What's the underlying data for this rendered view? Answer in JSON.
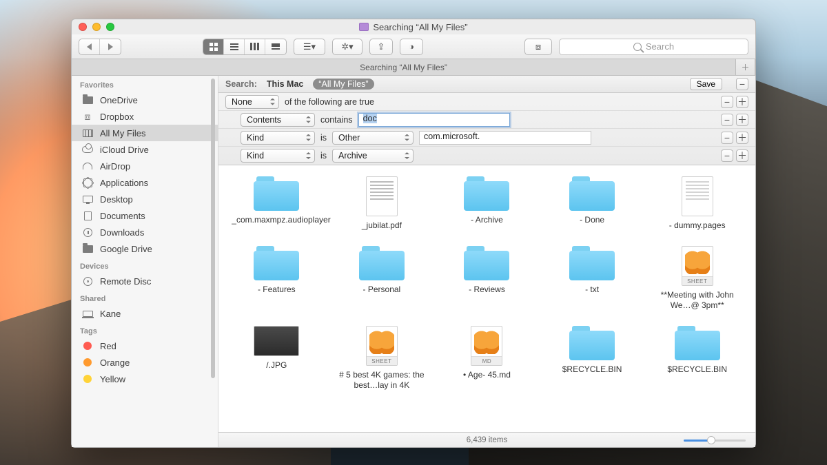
{
  "window": {
    "title": "Searching “All My Files”"
  },
  "toolbar": {
    "search_placeholder": "Search"
  },
  "tab": {
    "label": "Searching “All My Files”"
  },
  "sidebar": {
    "groups": {
      "favorites": "Favorites",
      "devices": "Devices",
      "shared": "Shared",
      "tags": "Tags"
    },
    "favorites": [
      {
        "label": "OneDrive"
      },
      {
        "label": "Dropbox"
      },
      {
        "label": "All My Files"
      },
      {
        "label": "iCloud Drive"
      },
      {
        "label": "AirDrop"
      },
      {
        "label": "Applications"
      },
      {
        "label": "Desktop"
      },
      {
        "label": "Documents"
      },
      {
        "label": "Downloads"
      },
      {
        "label": "Google Drive"
      }
    ],
    "devices": [
      {
        "label": "Remote Disc"
      }
    ],
    "shared": [
      {
        "label": "Kane"
      }
    ],
    "tags": [
      {
        "label": "Red",
        "color": "#ff5b51"
      },
      {
        "label": "Orange",
        "color": "#ff9a2e"
      },
      {
        "label": "Yellow",
        "color": "#ffd338"
      }
    ]
  },
  "search": {
    "label": "Search:",
    "scopes": [
      {
        "label": "This Mac",
        "active": false
      },
      {
        "label": "“All My Files”",
        "active": true
      }
    ],
    "save": "Save"
  },
  "criteria": {
    "root": {
      "select": "None",
      "text": "of the following are true"
    },
    "rows": [
      {
        "attr": "Contents",
        "op": "contains",
        "valueType": "text-focused",
        "value": "doc"
      },
      {
        "attr": "Kind",
        "op": "is",
        "valueType": "select+text",
        "select": "Other",
        "value": "com.microsoft."
      },
      {
        "attr": "Kind",
        "op": "is",
        "valueType": "select",
        "select": "Archive"
      }
    ]
  },
  "results": [
    {
      "kind": "folder",
      "name": "_com.maxmpz.audioplayer"
    },
    {
      "kind": "doc",
      "name": "_jubilat.pdf"
    },
    {
      "kind": "folder",
      "name": "- Archive"
    },
    {
      "kind": "folder",
      "name": "- Done"
    },
    {
      "kind": "doctxt",
      "name": "- dummy.pages"
    },
    {
      "kind": "folder",
      "name": "- Features"
    },
    {
      "kind": "folder",
      "name": "- Personal"
    },
    {
      "kind": "folder",
      "name": "- Reviews"
    },
    {
      "kind": "folder",
      "name": "- txt"
    },
    {
      "kind": "sheet",
      "tag": "SHEET",
      "name": "**Meeting with John We…@ 3pm**"
    },
    {
      "kind": "thumb",
      "name": "/.JPG"
    },
    {
      "kind": "sheet",
      "tag": "SHEET",
      "name": "# 5 best 4K games: the best…lay in 4K"
    },
    {
      "kind": "sheet",
      "tag": "MD",
      "name": "• Age- 45.md"
    },
    {
      "kind": "folder",
      "name": "$RECYCLE.BIN"
    },
    {
      "kind": "folder",
      "name": "$RECYCLE.BIN"
    }
  ],
  "status": {
    "items": "6,439 items"
  }
}
